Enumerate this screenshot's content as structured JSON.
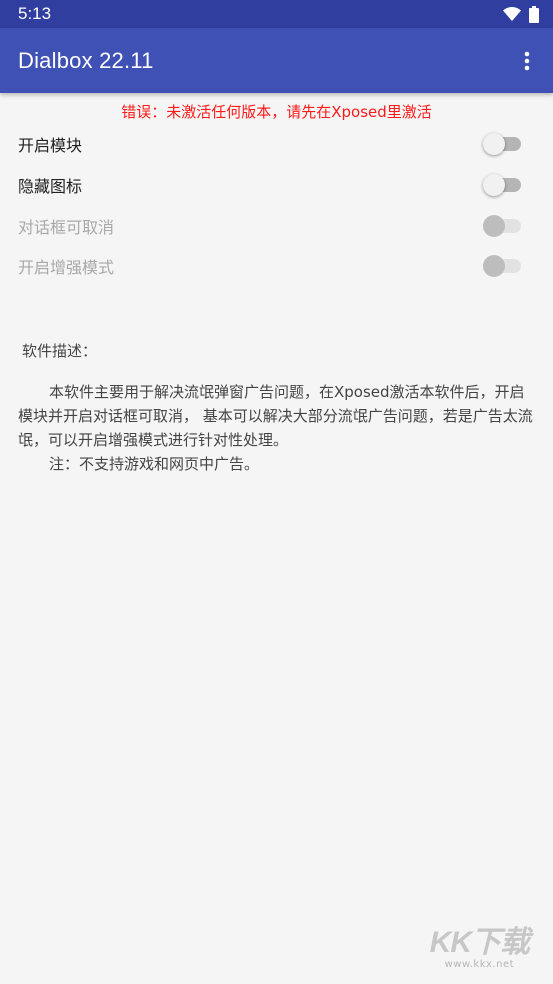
{
  "status_bar": {
    "time": "5:13",
    "icons": [
      "wifi-icon",
      "battery-icon"
    ]
  },
  "app_bar": {
    "title": "Dialbox 22.11",
    "menu_icon": "more-vert-icon"
  },
  "error_message": "错误：未激活任何版本，请先在Xposed里激活",
  "settings": [
    {
      "label": "开启模块",
      "enabled": true,
      "checked": false
    },
    {
      "label": "隐藏图标",
      "enabled": true,
      "checked": false
    },
    {
      "label": "对话框可取消",
      "enabled": false,
      "checked": false
    },
    {
      "label": "开启增强模式",
      "enabled": false,
      "checked": false
    }
  ],
  "description": {
    "title": "软件描述：",
    "body": "本软件主要用于解决流氓弹窗广告问题，在Xposed激活本软件后，开启模块并开启对话框可取消， 基本可以解决大部分流氓广告问题，若是广告太流氓，可以开启增强模式进行针对性处理。",
    "note": "注：不支持游戏和网页中广告。"
  },
  "watermark": {
    "brand": "KK下载",
    "url": "www.kkx.net"
  },
  "colors": {
    "status_bar": "#303f9f",
    "app_bar": "#3f51b5",
    "error": "#ff1a1a",
    "background": "#f5f5f5"
  }
}
